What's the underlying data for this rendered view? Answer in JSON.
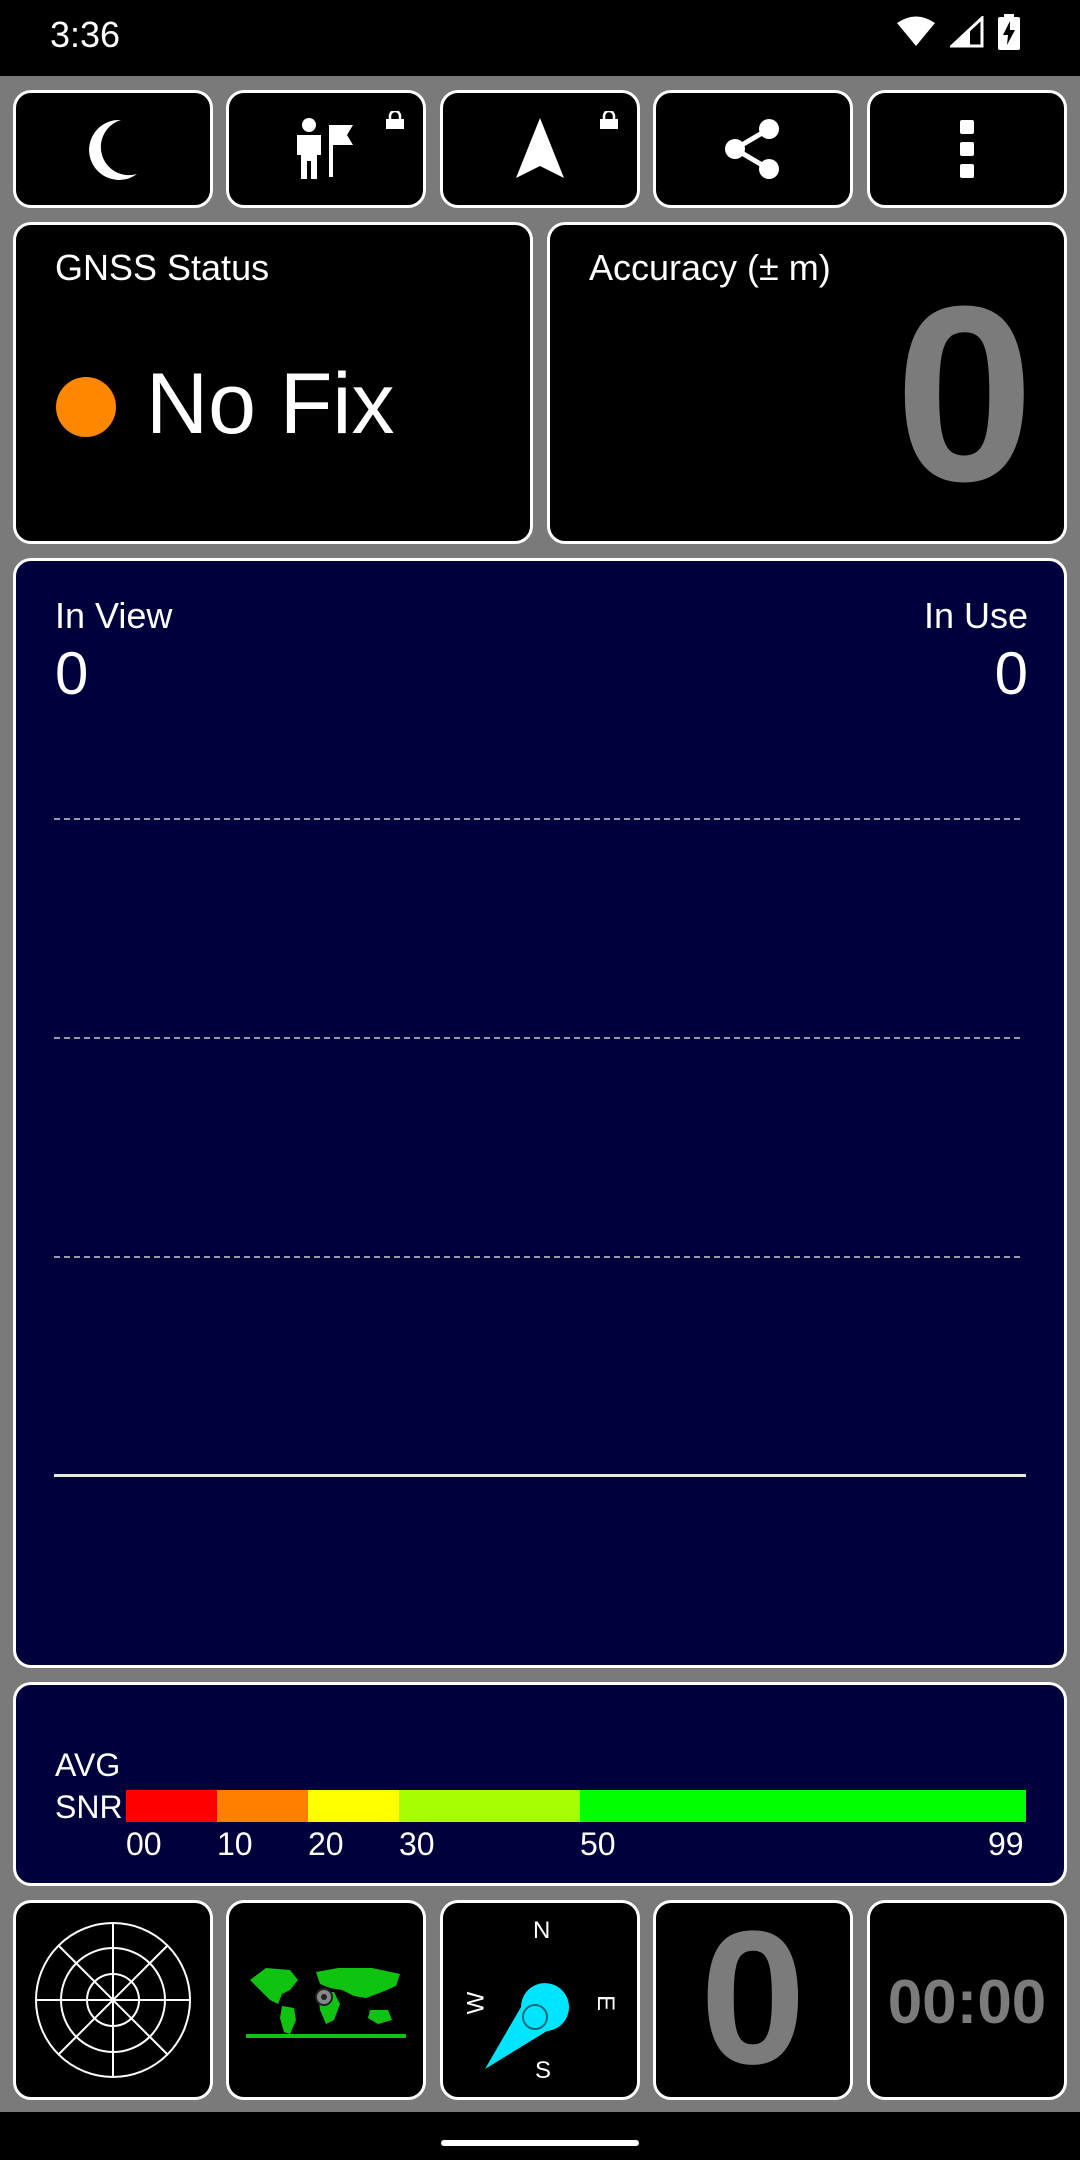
{
  "status_bar": {
    "time": "3:36",
    "icons": [
      "wifi-icon",
      "cell-signal-icon",
      "battery-charging-icon"
    ]
  },
  "toolbar": {
    "buttons": [
      {
        "name": "night-mode-button",
        "icon": "moon-icon",
        "locked": false
      },
      {
        "name": "waypoint-button",
        "icon": "person-flag-icon",
        "locked": true
      },
      {
        "name": "navigation-button",
        "icon": "navigation-arrow-icon",
        "locked": true
      },
      {
        "name": "share-button",
        "icon": "share-icon",
        "locked": false
      },
      {
        "name": "more-options-button",
        "icon": "more-vert-icon",
        "locked": false
      }
    ]
  },
  "gnss_status": {
    "title": "GNSS Status",
    "value": "No Fix",
    "indicator_color": "#ff8800"
  },
  "accuracy": {
    "title": "Accuracy (± m)",
    "value": "0"
  },
  "satellites": {
    "in_view_label": "In View",
    "in_view_value": "0",
    "in_use_label": "In Use",
    "in_use_value": "0"
  },
  "snr": {
    "label_line1": "AVG",
    "label_line2": "SNR",
    "ticks": [
      "00",
      "10",
      "20",
      "30",
      "50",
      "99"
    ],
    "colors": [
      "#ff0000",
      "#ff8000",
      "#ffff00",
      "#a6ff00",
      "#00ff00"
    ]
  },
  "bottom_bar": {
    "compass": {
      "n": "N",
      "s": "S",
      "e": "E",
      "w": "W"
    },
    "speed_value": "0",
    "timer_value": "00:00"
  }
}
